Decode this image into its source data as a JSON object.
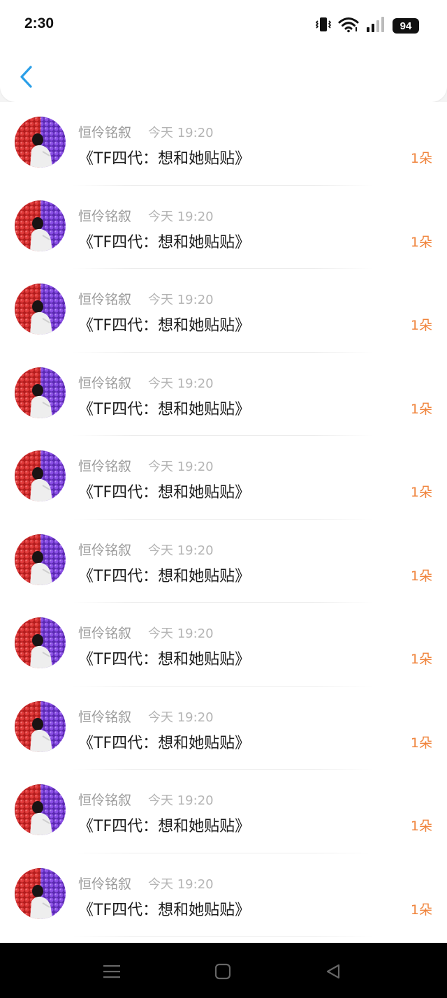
{
  "status_bar": {
    "time": "2:30",
    "battery": "94",
    "icons": [
      "vibrate-icon",
      "wifi-icon",
      "signal-icon",
      "battery-icon"
    ]
  },
  "header": {
    "back_icon": "chevron-left-icon",
    "accent_color": "#2b9fe8"
  },
  "list": {
    "items": [
      {
        "name": "恒伶铭叙",
        "time": "今天 19:20",
        "title": "《TF四代：想和她贴贴》",
        "count": "1朵"
      },
      {
        "name": "恒伶铭叙",
        "time": "今天 19:20",
        "title": "《TF四代：想和她贴贴》",
        "count": "1朵"
      },
      {
        "name": "恒伶铭叙",
        "time": "今天 19:20",
        "title": "《TF四代：想和她贴贴》",
        "count": "1朵"
      },
      {
        "name": "恒伶铭叙",
        "time": "今天 19:20",
        "title": "《TF四代：想和她贴贴》",
        "count": "1朵"
      },
      {
        "name": "恒伶铭叙",
        "time": "今天 19:20",
        "title": "《TF四代：想和她贴贴》",
        "count": "1朵"
      },
      {
        "name": "恒伶铭叙",
        "time": "今天 19:20",
        "title": "《TF四代：想和她贴贴》",
        "count": "1朵"
      },
      {
        "name": "恒伶铭叙",
        "time": "今天 19:20",
        "title": "《TF四代：想和她贴贴》",
        "count": "1朵"
      },
      {
        "name": "恒伶铭叙",
        "time": "今天 19:20",
        "title": "《TF四代：想和她贴贴》",
        "count": "1朵"
      },
      {
        "name": "恒伶铭叙",
        "time": "今天 19:20",
        "title": "《TF四代：想和她贴贴》",
        "count": "1朵"
      },
      {
        "name": "恒伶铭叙",
        "time": "今天 19:20",
        "title": "《TF四代：想和她贴贴》",
        "count": "1朵"
      }
    ]
  },
  "colors": {
    "count_color": "#f0843c",
    "name_color": "#9a9a9a",
    "avatar_red": "#d42a2a",
    "avatar_purple": "#7a3fd6"
  },
  "navigation_bar": {
    "icons": [
      "menu-icon",
      "home-square-icon",
      "back-triangle-icon"
    ]
  }
}
